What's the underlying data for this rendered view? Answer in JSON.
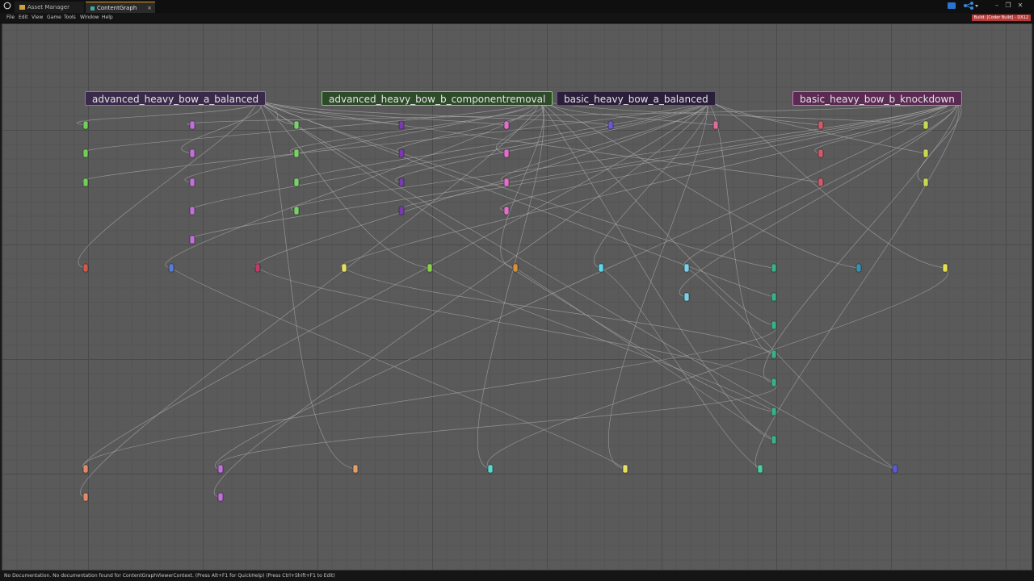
{
  "tabs": [
    {
      "label": "Asset Manager",
      "icon": "folder-icon",
      "active": false
    },
    {
      "label": "ContentGraph",
      "icon": "graph-icon",
      "active": true,
      "close": "×"
    }
  ],
  "window_controls": [
    "–",
    "❐",
    "✕"
  ],
  "menu": [
    "File",
    "Edit",
    "View",
    "Game",
    "Tools",
    "Window",
    "Help"
  ],
  "build_badge": "Build: [Coder Build] - DX12",
  "status_text": "No Documentation. No documentation found for ContentGraphViewerContext. (Press Alt+F1 for QuickHelp) (Press Ctrl+Shift+F1 to Edit)",
  "colors": {
    "viewport_bg": "#5a5a5a",
    "wire": "#a8a8a8",
    "accent": "#e39a21",
    "badge": "#b73a3a"
  },
  "graph_nodes": [
    {
      "label": "advanced_heavy_bow_a_balanced",
      "color": "#3a2a4a",
      "border": "#9a6ac0"
    },
    {
      "label": "advanced_heavy_bow_b_componentremoval",
      "color": "#2e4a2a",
      "border": "#7ad06a"
    },
    {
      "label": "basic_heavy_bow_a_balanced",
      "color": "#2a1e3a",
      "border": "#6a4a90"
    },
    {
      "label": "basic_heavy_bow_b_knockdown",
      "color": "#5a2a52",
      "border": "#d070c0"
    }
  ]
}
